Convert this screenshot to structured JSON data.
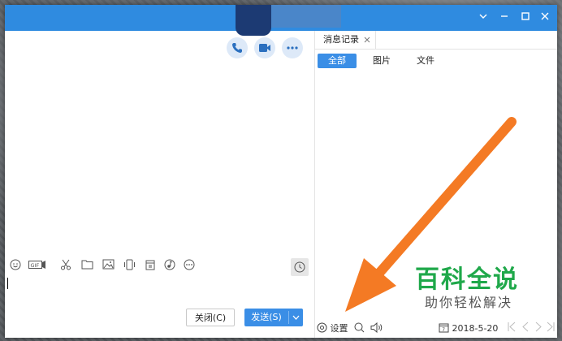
{
  "right_panel": {
    "tab_label": "消息记录",
    "filters": [
      "全部",
      "图片",
      "文件"
    ],
    "settings_label": "设置",
    "date": "2018-5-20"
  },
  "input": {
    "close_label": "关闭(C)",
    "send_label": "发送(S)"
  },
  "watermark": {
    "title": "百科全说",
    "subtitle": "助你轻松解决"
  },
  "colors": {
    "titlebar": "#2f8be0",
    "accent": "#3a8ee6",
    "arrow": "#f47a24",
    "watermark_green": "#1fa84a"
  },
  "icons": {
    "toolbar": [
      "emoji-icon",
      "gif-icon",
      "scissors-icon",
      "folder-icon",
      "image-icon",
      "shake-icon",
      "calendar-note-icon",
      "music-icon",
      "more-icon"
    ],
    "actions": [
      "phone-icon",
      "video-icon",
      "more-icon"
    ]
  }
}
